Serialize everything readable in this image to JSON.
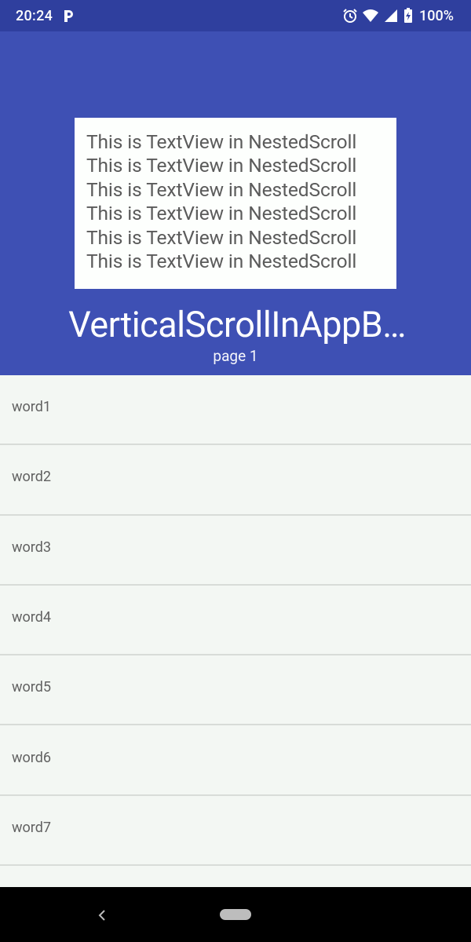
{
  "status_bar": {
    "time": "20:24",
    "battery_percent": "100%",
    "icons": [
      "p-notification-icon",
      "alarm-icon",
      "wifi-icon",
      "signal-icon",
      "battery-charging-icon"
    ]
  },
  "app_bar": {
    "nested_text_lines": [
      "This is TextView in NestedScroll",
      "This is TextView in NestedScroll",
      "This is TextView in NestedScroll",
      "This is TextView in NestedScroll",
      "This is TextView in NestedScroll",
      "This is TextView in NestedScroll"
    ],
    "title": "VerticalScrollInAppB…",
    "subtitle": "page 1",
    "background_color": "#3e50b4"
  },
  "list": {
    "items": [
      "word1",
      "word2",
      "word3",
      "word4",
      "word5",
      "word6",
      "word7"
    ]
  },
  "nav_bar": {
    "icons": [
      "back-icon",
      "home-pill-icon"
    ]
  }
}
